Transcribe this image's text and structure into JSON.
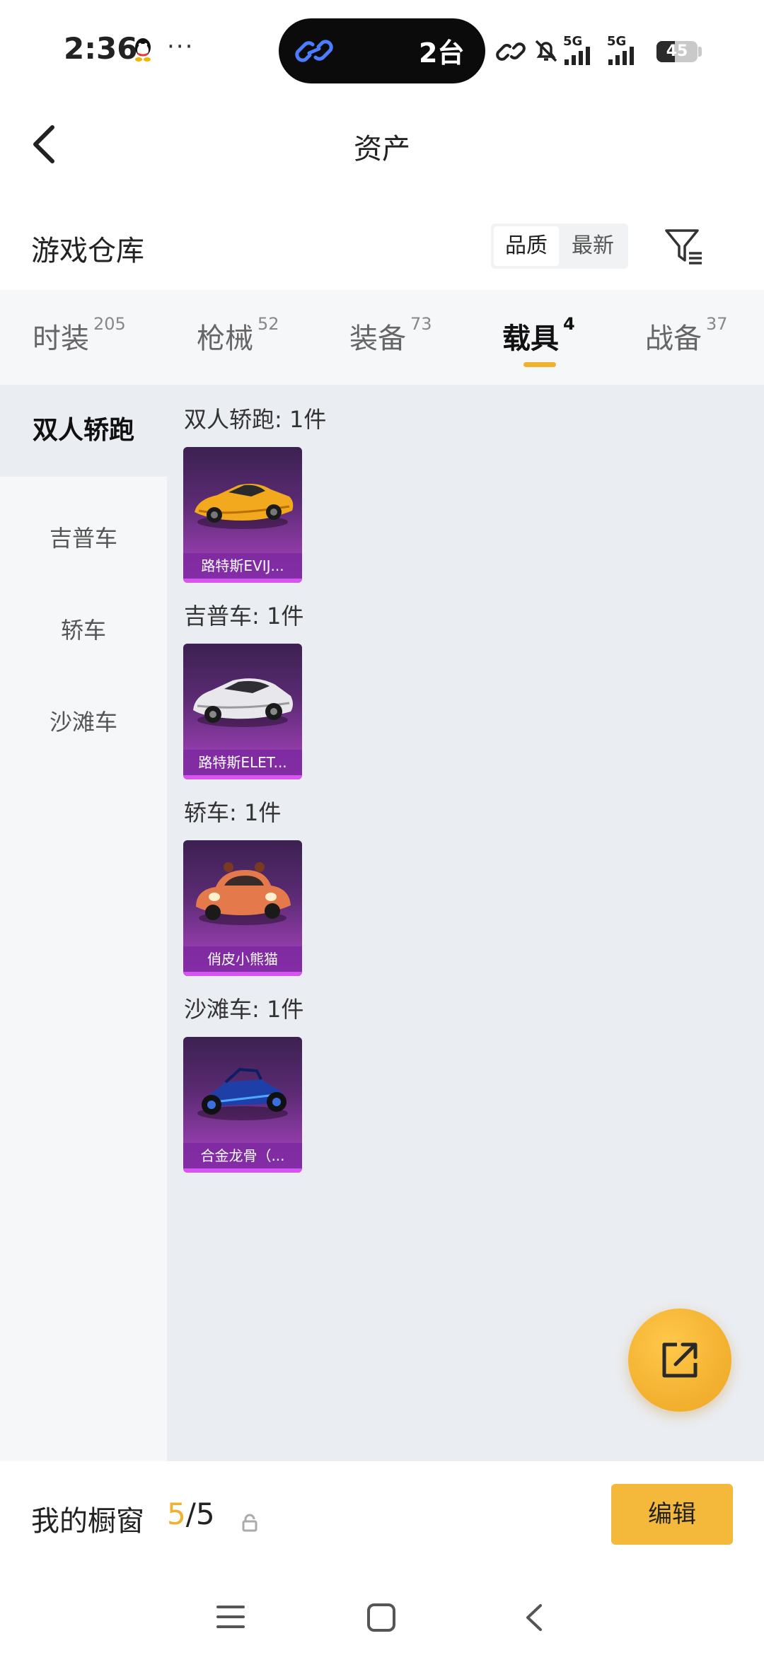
{
  "status_bar": {
    "time": "2:36",
    "more": "···",
    "island_text": "2台",
    "net1": "5G",
    "net2": "5G",
    "battery_level": 45,
    "battery_text": "45"
  },
  "header": {
    "title": "资产"
  },
  "warehouse": {
    "title": "游戏仓库",
    "sort_options": [
      "品质",
      "最新"
    ],
    "sort_selected": "品质"
  },
  "tabs": [
    {
      "label": "时装",
      "count": "205"
    },
    {
      "label": "枪械",
      "count": "52"
    },
    {
      "label": "装备",
      "count": "73"
    },
    {
      "label": "载具",
      "count": "4",
      "active": true
    },
    {
      "label": "战备",
      "count": "37"
    }
  ],
  "side_nav": [
    {
      "label": "双人轿跑",
      "active": true
    },
    {
      "label": "吉普车"
    },
    {
      "label": "轿车"
    },
    {
      "label": "沙滩车"
    }
  ],
  "groups": [
    {
      "label": "双人轿跑: 1件",
      "items": [
        {
          "name": "路特斯EVIJ...",
          "icon": "yellow-sports-car"
        }
      ]
    },
    {
      "label": "吉普车: 1件",
      "items": [
        {
          "name": "路特斯ELET...",
          "icon": "white-suv"
        }
      ]
    },
    {
      "label": "轿车: 1件",
      "items": [
        {
          "name": "俏皮小熊猫",
          "icon": "orange-panda-car"
        }
      ]
    },
    {
      "label": "沙滩车: 1件",
      "items": [
        {
          "name": "合金龙骨（...",
          "icon": "blue-buggy"
        }
      ]
    }
  ],
  "showcase": {
    "label": "我的橱窗",
    "current": "5",
    "total": "/5",
    "edit_label": "编辑"
  },
  "colors": {
    "accent": "#f0b12e",
    "card_purple": "#8b3aa3",
    "content_bg": "#eaedf2"
  }
}
